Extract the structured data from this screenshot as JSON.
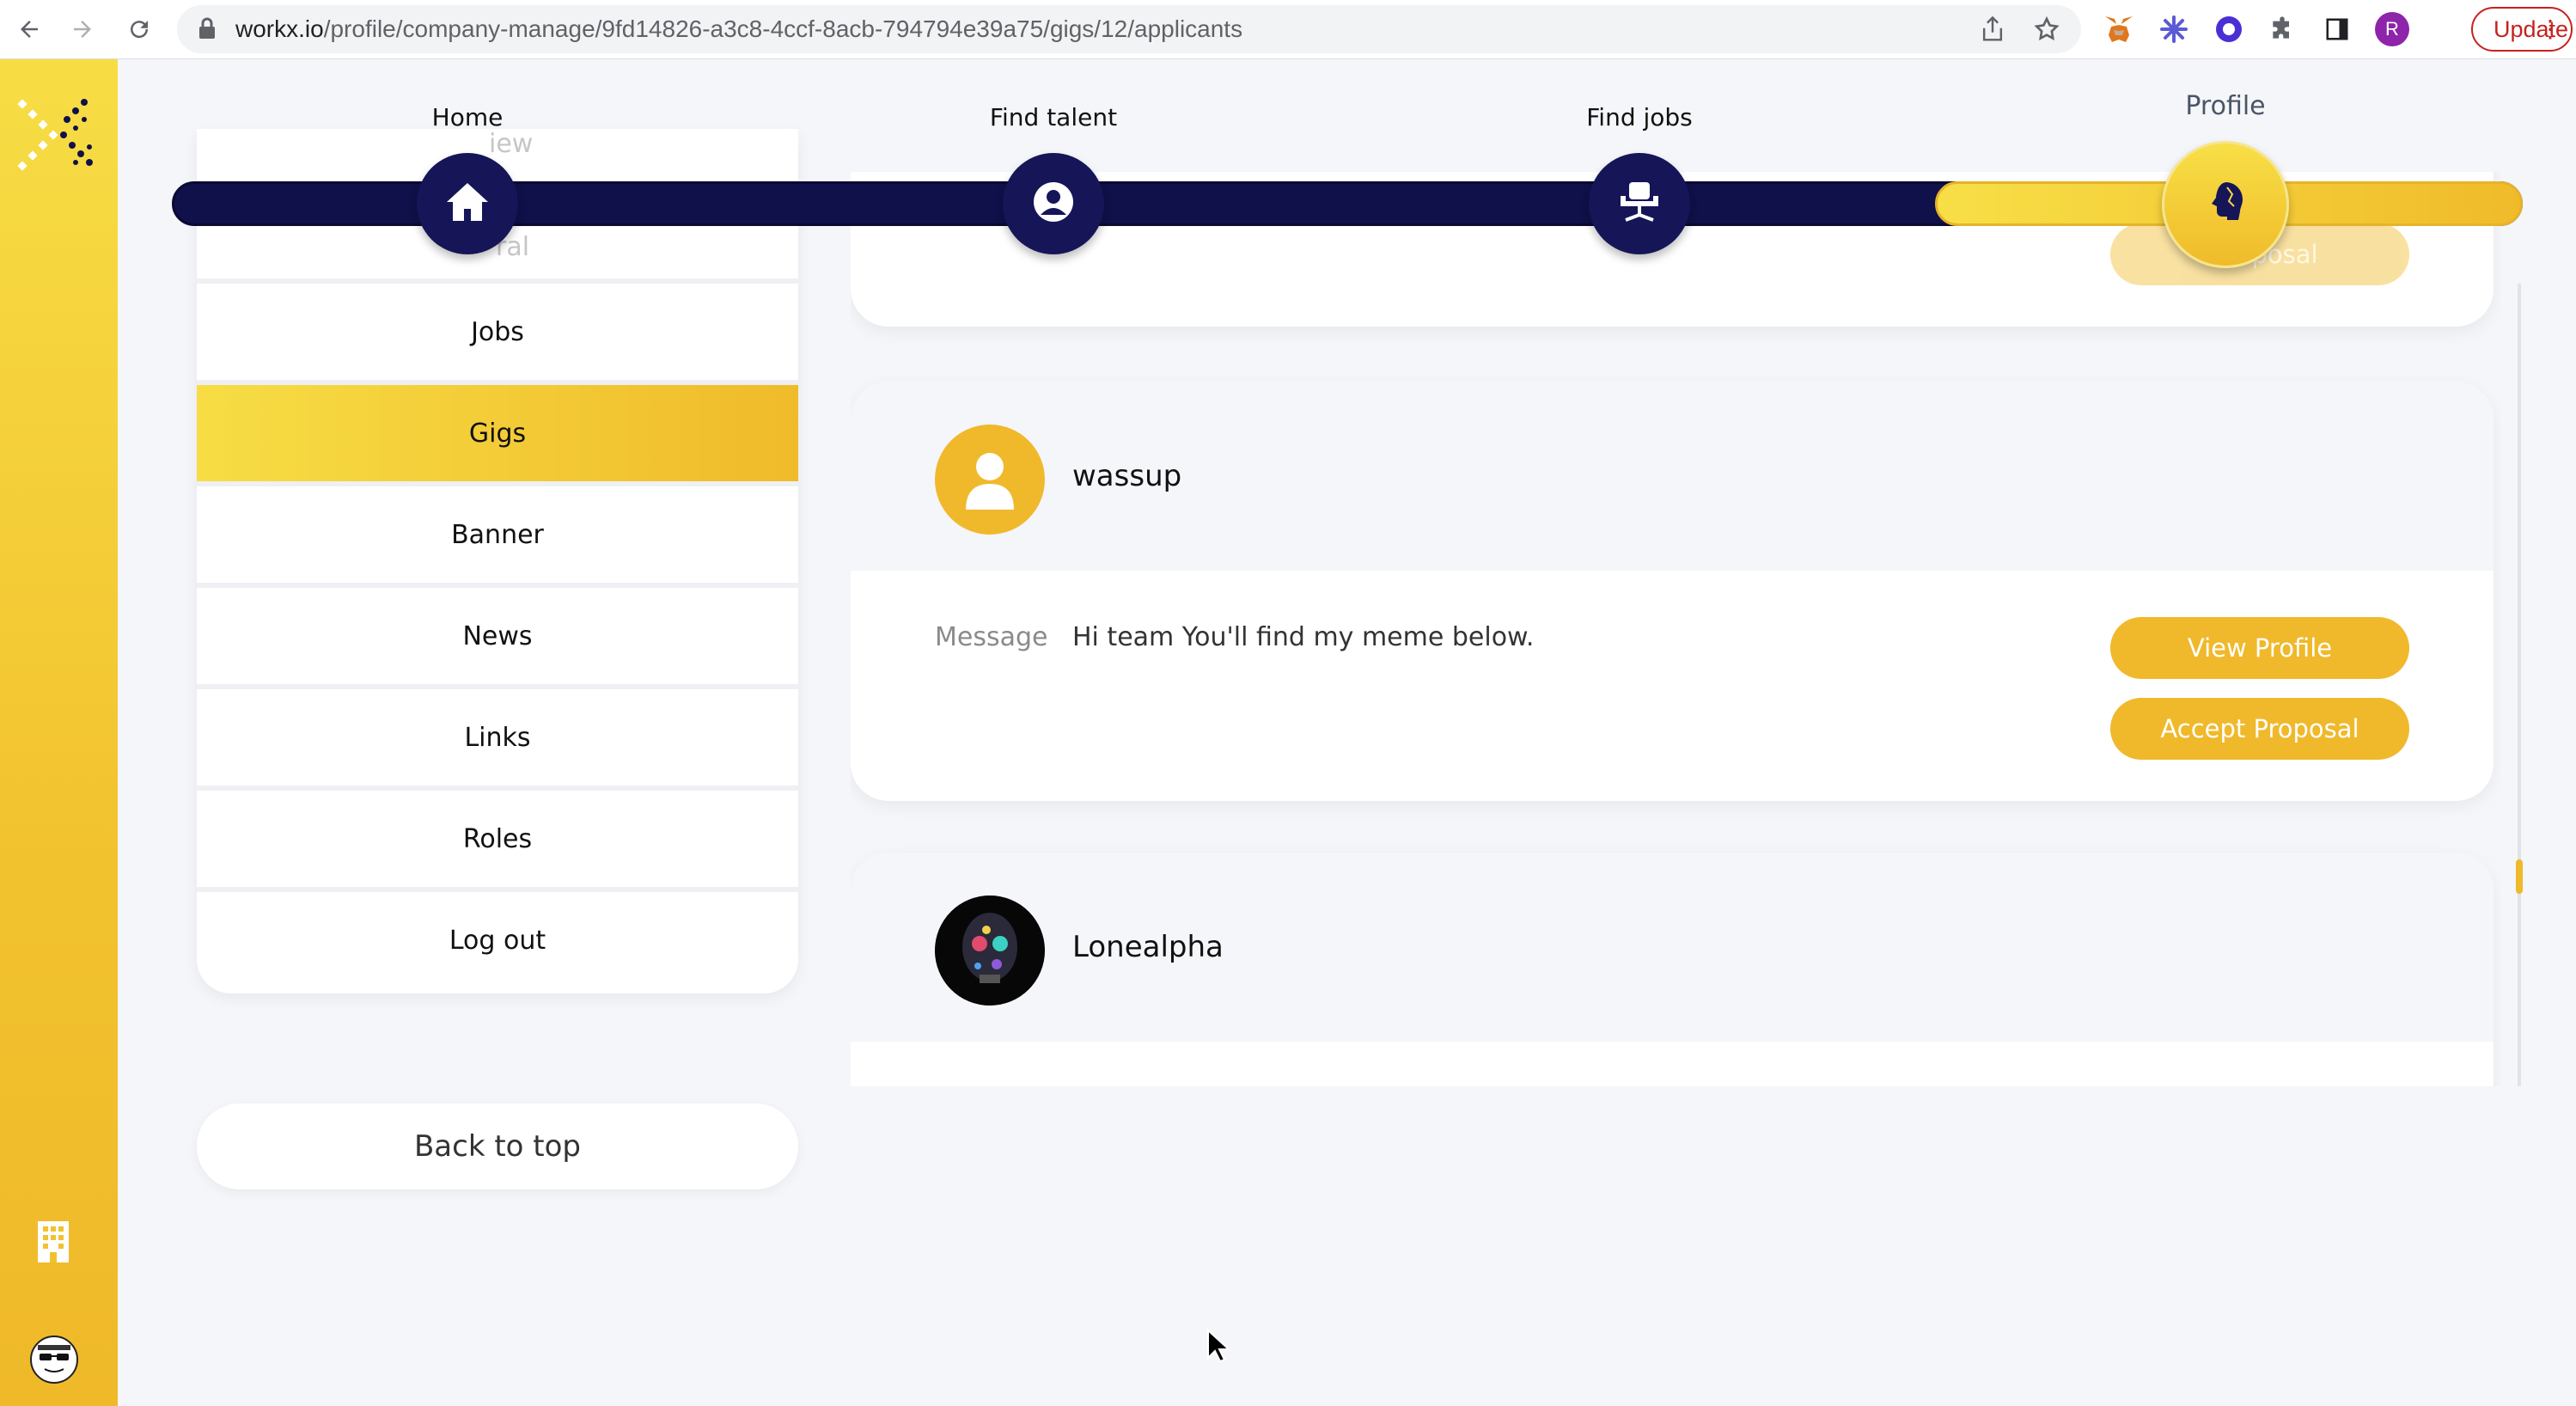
{
  "browser": {
    "url_host": "workx.io",
    "url_path": "/profile/company-manage/9fd14826-a3c8-4ccf-8acb-794794e39a75/gigs/12/applicants",
    "profile_initial": "R",
    "update_label": "Update"
  },
  "topnav": {
    "items": [
      {
        "label": "Home",
        "icon": "home-icon"
      },
      {
        "label": "Find talent",
        "icon": "user-circle-icon"
      },
      {
        "label": "Find jobs",
        "icon": "office-chair-icon"
      },
      {
        "label": "Profile",
        "icon": "profile-head-icon"
      }
    ]
  },
  "menu": {
    "ghost_items": [
      "iew",
      "ral"
    ],
    "items": [
      "Jobs",
      "Gigs",
      "Banner",
      "News",
      "Links",
      "Roles",
      "Log out"
    ],
    "active": "Gigs",
    "back_to_top": "Back to top"
  },
  "applicants": [
    {
      "name": "wassup",
      "message_label": "Message",
      "message": "Hi team You'll find my meme below.",
      "view_profile_label": "View Profile",
      "accept_label": "Accept Proposal"
    },
    {
      "name": "Lonealpha"
    }
  ],
  "previous_card": {
    "accept_label_partial": "A      roposal"
  },
  "colors": {
    "accent_yellow": "#f0b92b",
    "navy": "#10104a",
    "bottom_bar": "#05052a"
  }
}
